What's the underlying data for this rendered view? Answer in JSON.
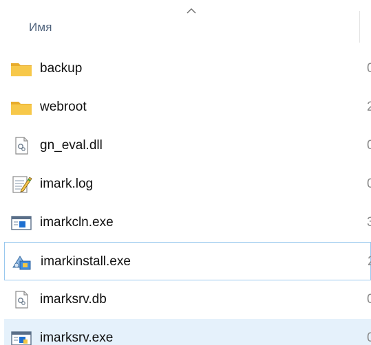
{
  "header": {
    "name_column": "Имя"
  },
  "files": [
    {
      "name": "backup",
      "icon": "folder-icon"
    },
    {
      "name": "webroot",
      "icon": "folder-icon"
    },
    {
      "name": "gn_eval.dll",
      "icon": "dll-file-icon"
    },
    {
      "name": "imark.log",
      "icon": "log-file-icon"
    },
    {
      "name": "imarkcln.exe",
      "icon": "exe-window-icon"
    },
    {
      "name": "imarkinstall.exe",
      "icon": "installer-icon",
      "state": "focused"
    },
    {
      "name": "imarksrv.db",
      "icon": "db-file-icon"
    },
    {
      "name": "imarksrv.exe",
      "icon": "exe-window-icon",
      "state": "selected"
    }
  ],
  "colors": {
    "header_text": "#4c607a",
    "folder": "#f5c142",
    "selection_bg": "#e5f1fb",
    "focus_border": "#99c8ee"
  }
}
